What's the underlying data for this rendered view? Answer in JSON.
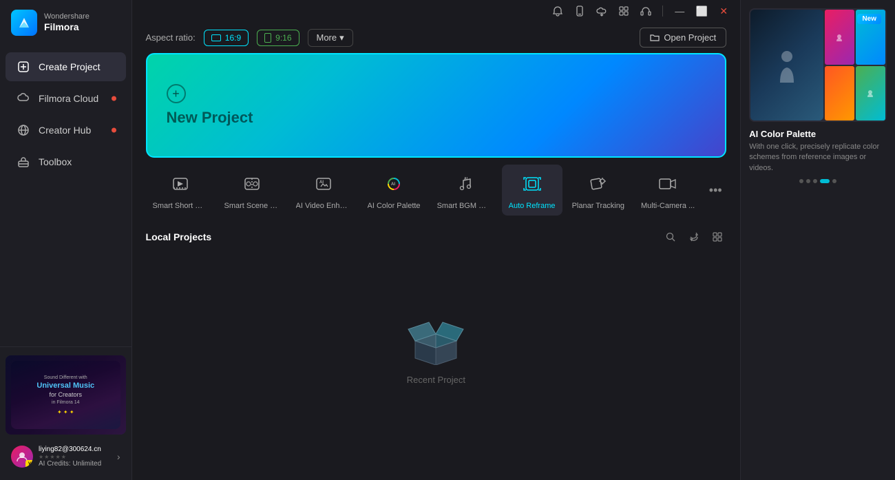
{
  "app": {
    "brand": "Wondershare",
    "name": "Filmora"
  },
  "titlebar": {
    "icons": [
      "notification",
      "mobile",
      "cloud",
      "apps",
      "headset"
    ],
    "window_controls": [
      "minimize",
      "maximize",
      "close"
    ]
  },
  "sidebar": {
    "items": [
      {
        "id": "create-project",
        "label": "Create Project",
        "icon": "➕",
        "active": true,
        "badge": false
      },
      {
        "id": "filmora-cloud",
        "label": "Filmora Cloud",
        "icon": "☁",
        "active": false,
        "badge": true
      },
      {
        "id": "creator-hub",
        "label": "Creator Hub",
        "icon": "🌐",
        "active": false,
        "badge": true
      },
      {
        "id": "toolbox",
        "label": "Toolbox",
        "icon": "🧰",
        "active": false,
        "badge": false
      }
    ]
  },
  "header": {
    "aspect_ratio_label": "Aspect ratio:",
    "aspect_16_9": "16:9",
    "aspect_9_16": "9:16",
    "more_label": "More",
    "open_project_label": "Open Project"
  },
  "new_project": {
    "icon": "+",
    "label": "New Project"
  },
  "ai_tools": [
    {
      "id": "smart-short-clip",
      "label": "Smart Short Cli...",
      "active": false
    },
    {
      "id": "smart-scene-cut",
      "label": "Smart Scene Cut",
      "active": false
    },
    {
      "id": "ai-video-enhance",
      "label": "AI Video Enhan...",
      "active": false
    },
    {
      "id": "ai-color-palette",
      "label": "AI Color Palette",
      "active": false
    },
    {
      "id": "smart-bgm-gen",
      "label": "Smart BGM Ge...",
      "active": false
    },
    {
      "id": "auto-reframe",
      "label": "Auto Reframe",
      "active": true
    },
    {
      "id": "planar-tracking",
      "label": "Planar Tracking",
      "active": false
    },
    {
      "id": "multi-camera",
      "label": "Multi-Camera ...",
      "active": false
    }
  ],
  "local_projects": {
    "title": "Local Projects",
    "empty_text": "Recent Project"
  },
  "right_panel": {
    "new_badge": "New",
    "promo_title": "AI Color Palette",
    "promo_desc": "With one click, precisely replicate color schemes from reference images or videos.",
    "dots": [
      0,
      1,
      2,
      3,
      4
    ],
    "active_dot": 3
  },
  "user": {
    "name": "liying82@300624.cn",
    "credits": "AI Credits: Unlimited",
    "vip": "VIP"
  },
  "banner": {
    "title": "Sound Different with",
    "highlight": "Universal Music",
    "sub": "for Creators",
    "sub2": "in Filmora 14"
  }
}
